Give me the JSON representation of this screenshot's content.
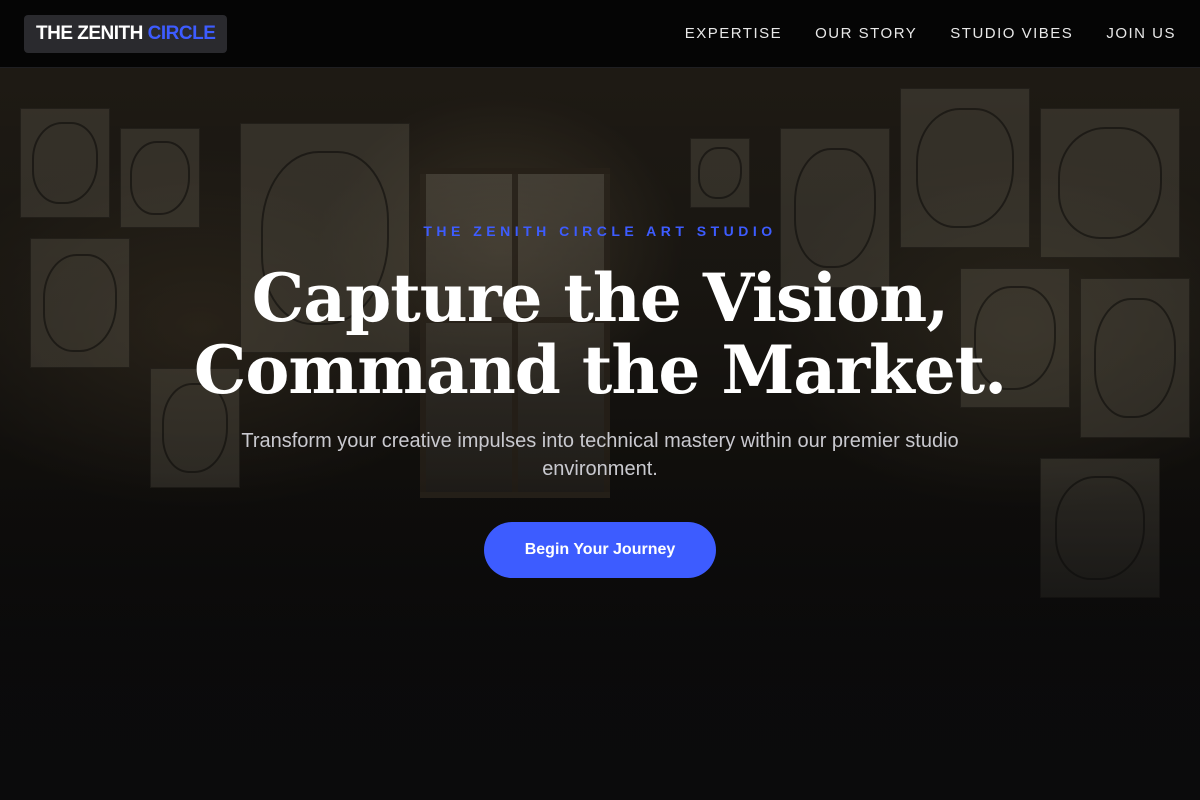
{
  "navbar": {
    "logo_primary": "THE ZENITH",
    "logo_accent": "CIRCLE",
    "links": [
      {
        "label": "EXPERTISE"
      },
      {
        "label": "OUR STORY"
      },
      {
        "label": "STUDIO VIBES"
      },
      {
        "label": "JOIN US"
      }
    ]
  },
  "hero": {
    "eyebrow": "THE ZENITH CIRCLE ART STUDIO",
    "headline_line1": "Capture the Vision,",
    "headline_line2": "Command the Market.",
    "subtext": "Transform your creative impulses into technical mastery within our premier studio environment.",
    "cta_label": "Begin Your Journey"
  },
  "colors": {
    "accent": "#3d5cff",
    "nav_background": "#050505",
    "page_background": "#0b0b0c"
  }
}
